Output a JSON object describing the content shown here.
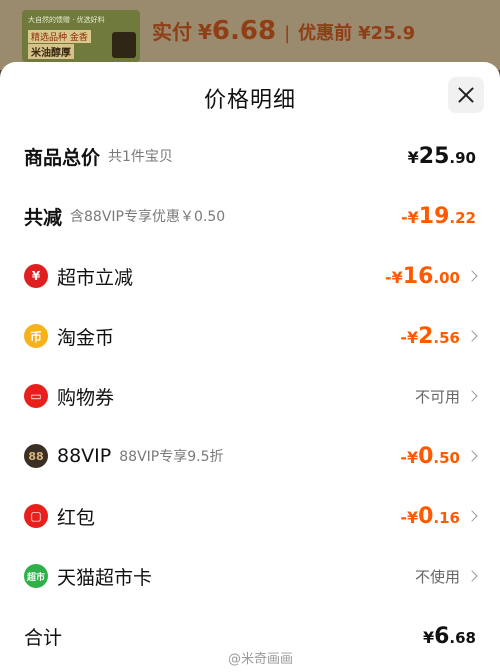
{
  "topbar": {
    "product_strip": "大自然的馈赠 · 优选好料",
    "product_text1": "精选品种 金香",
    "product_text2": "米油醇厚",
    "paid_label": "实付",
    "paid_yen": "¥",
    "paid_amount": "6.68",
    "separator": "|",
    "pre_label": "优惠前",
    "pre_amount": "¥25.9"
  },
  "sheet": {
    "title": "价格明细",
    "rows": [
      {
        "label": "商品总价",
        "sub": "共1件宝贝",
        "yen": "¥",
        "int": "25",
        "dec": ".90"
      },
      {
        "label": "共减",
        "sub": "含88VIP专享优惠￥0.50",
        "yen": "-¥",
        "int": "19",
        "dec": ".22"
      },
      {
        "label": "超市立减",
        "icon": "market-icon",
        "yen": "-¥",
        "int": "16",
        "dec": ".00"
      },
      {
        "label": "淘金币",
        "icon": "coin-icon",
        "yen": "-¥",
        "int": "2",
        "dec": ".56"
      },
      {
        "label": "购物券",
        "icon": "coupon-icon",
        "status": "不可用"
      },
      {
        "label": "88VIP",
        "sub": "88VIP专享9.5折",
        "icon": "vip-icon",
        "icon_text": "88",
        "yen": "-¥",
        "int": "0",
        "dec": ".50"
      },
      {
        "label": "红包",
        "icon": "red-packet-icon",
        "yen": "-¥",
        "int": "0",
        "dec": ".16"
      },
      {
        "label": "天猫超市卡",
        "icon": "tmall-card-icon",
        "icon_text": "超市",
        "status": "不使用"
      },
      {
        "label": "合计",
        "yen": "¥",
        "int": "6",
        "dec": ".68"
      }
    ]
  },
  "watermark": "@米奇画画",
  "colors": {
    "accent": "#ff5a00",
    "text": "#111111"
  }
}
